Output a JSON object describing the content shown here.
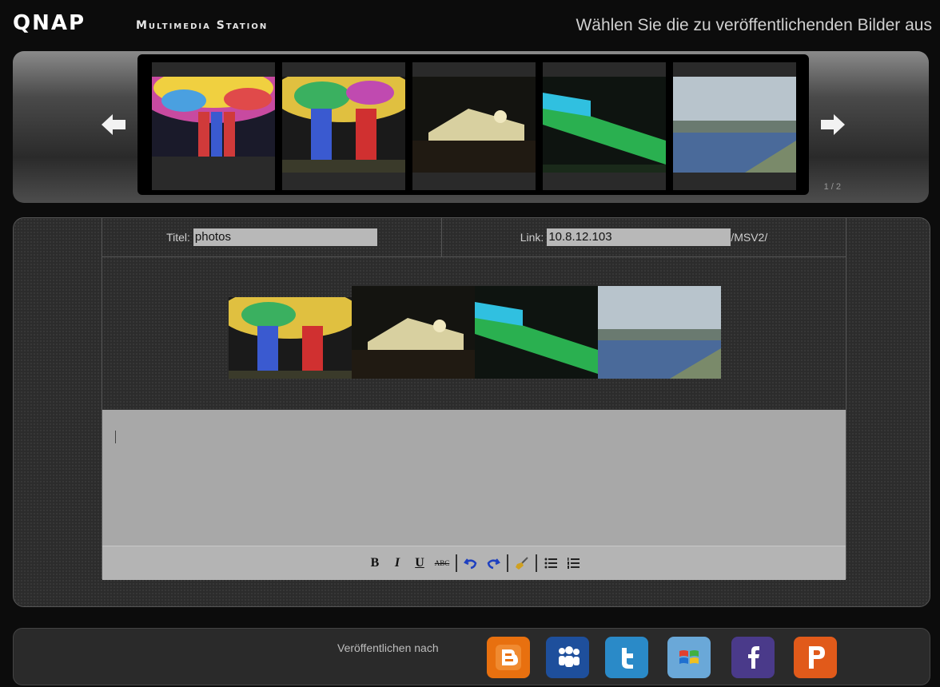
{
  "header": {
    "logo": "QNAP",
    "app_name": "Multimedia Station",
    "title": "Wählen Sie die zu veröffentlichenden Bilder aus"
  },
  "strip": {
    "page_indicator": "1 / 2",
    "thumbnails": [
      "colorful-dome",
      "colorful-dome-pillars",
      "night-tent",
      "green-lit-bridge",
      "waterfront-walkway"
    ]
  },
  "form": {
    "title_label": "Titel:",
    "title_value": "photos",
    "link_label": "Link:",
    "link_value": "10.8.12.103",
    "link_suffix": "/MSV2/"
  },
  "toolbar": {
    "bold": "B",
    "italic": "I",
    "underline": "U",
    "strike": "ABC"
  },
  "publish": {
    "label": "Veröffentlichen nach",
    "services": [
      "blogger",
      "myspace",
      "twitter",
      "windows-live",
      "facebook",
      "plurk"
    ]
  },
  "colors": {
    "blogger": "#e8700f",
    "myspace": "#1e4f9c",
    "twitter": "#2a8ac8",
    "windows-live": "#3a8fcf",
    "facebook": "#4a3a8a",
    "plurk": "#e15a1a"
  }
}
